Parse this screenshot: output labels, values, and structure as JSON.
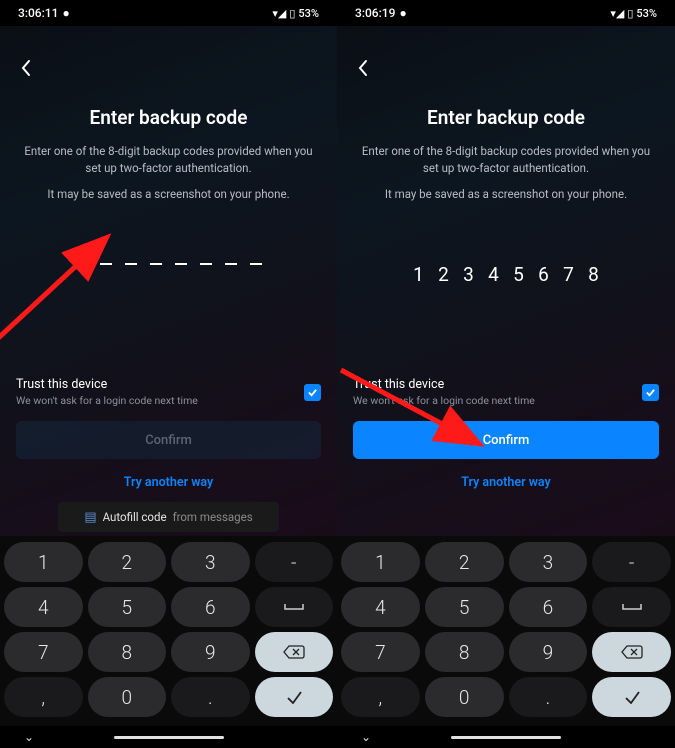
{
  "screens": [
    {
      "status": {
        "time": "3:06:11",
        "battery": "53%"
      },
      "title": "Enter backup code",
      "subtitle": "Enter one of the 8-digit backup codes provided when you set up two-factor authentication.",
      "hint": "It may be saved as a screenshot on your phone.",
      "code": [
        "",
        "",
        "",
        "",
        "",
        "",
        "",
        ""
      ],
      "trust": {
        "title": "Trust this device",
        "sub": "We won't ask for a login code next time",
        "checked": true
      },
      "confirm": {
        "label": "Confirm",
        "enabled": false
      },
      "another": "Try another way",
      "autofill": {
        "label": "Autofill code",
        "src": "from messages"
      }
    },
    {
      "status": {
        "time": "3:06:19",
        "battery": "53%"
      },
      "title": "Enter backup code",
      "subtitle": "Enter one of the 8-digit backup codes provided when you set up two-factor authentication.",
      "hint": "It may be saved as a screenshot on your phone.",
      "code": [
        "1",
        "2",
        "3",
        "4",
        "5",
        "6",
        "7",
        "8"
      ],
      "trust": {
        "title": "Trust this device",
        "sub": "We won't ask for a login code next time",
        "checked": true
      },
      "confirm": {
        "label": "Confirm",
        "enabled": true
      },
      "another": "Try another way"
    }
  ],
  "keypad": {
    "rows": [
      [
        "1",
        "2",
        "3",
        "-"
      ],
      [
        "4",
        "5",
        "6",
        "␣"
      ],
      [
        "7",
        "8",
        "9",
        "⌫"
      ],
      [
        ",",
        "0",
        ".",
        "✓"
      ]
    ]
  }
}
